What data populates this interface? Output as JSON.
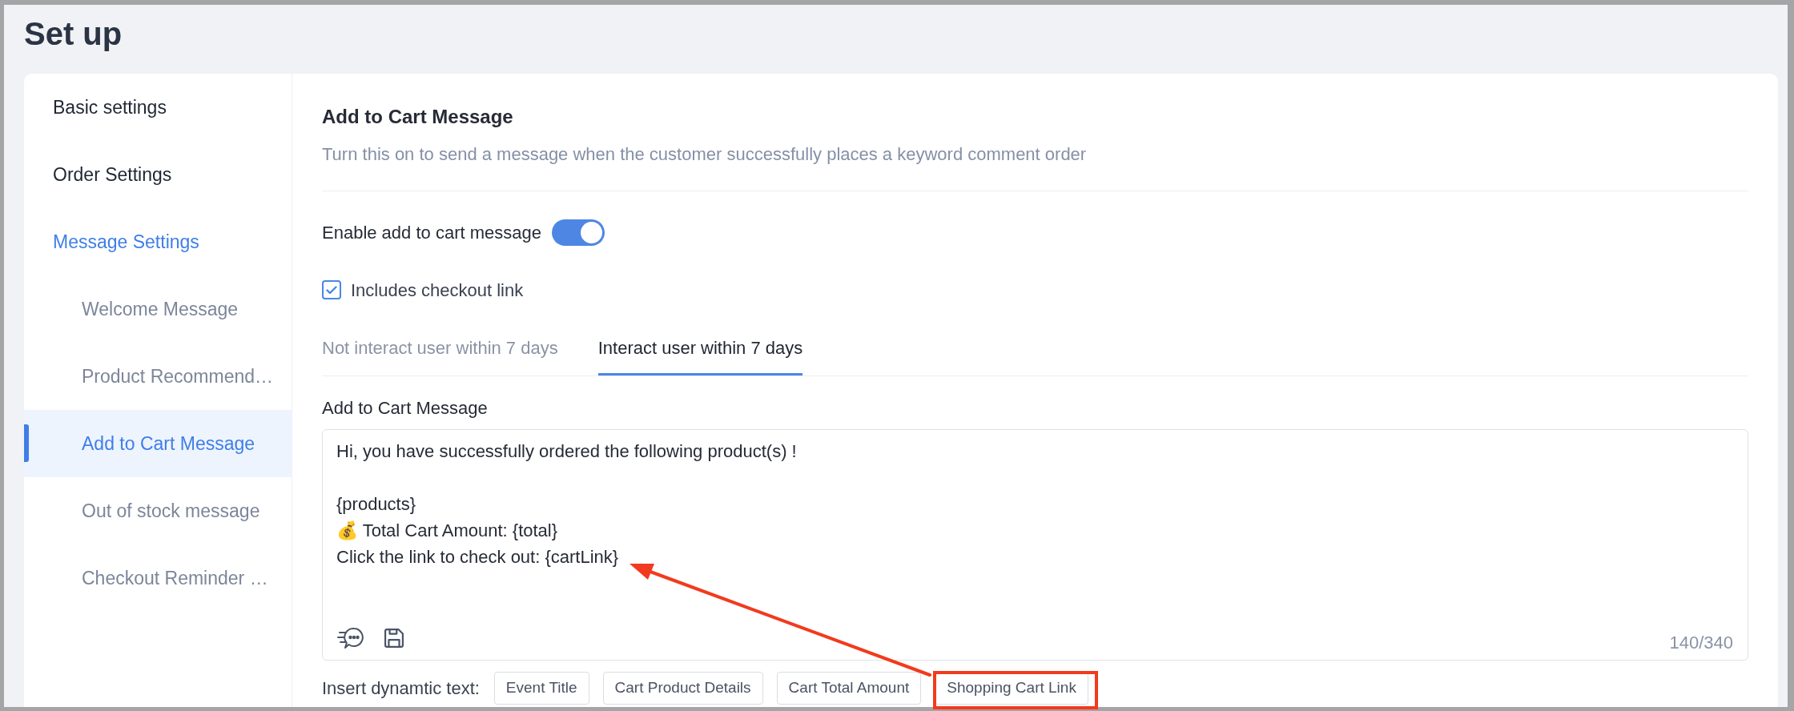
{
  "page": {
    "title": "Set up"
  },
  "sidebar": {
    "items": [
      {
        "label": "Basic settings",
        "selected": false
      },
      {
        "label": "Order Settings",
        "selected": false
      },
      {
        "label": "Message Settings",
        "selected": true,
        "children": [
          {
            "label": "Welcome Message",
            "selected": false
          },
          {
            "label": "Product Recommend…",
            "selected": false
          },
          {
            "label": "Add to Cart Message",
            "selected": true
          },
          {
            "label": "Out of stock message",
            "selected": false
          },
          {
            "label": "Checkout Reminder …",
            "selected": false
          }
        ]
      }
    ]
  },
  "section": {
    "title": "Add to Cart Message",
    "description": "Turn this on to send a message when the customer successfully places a keyword comment order"
  },
  "enable_toggle": {
    "label": "Enable add to cart message",
    "on": true
  },
  "checkout_checkbox": {
    "label": "Includes checkout link",
    "checked": true
  },
  "tabs": [
    {
      "label": "Not interact user within 7 days",
      "selected": false
    },
    {
      "label": "Interact user within 7 days",
      "selected": true
    }
  ],
  "message": {
    "label": "Add to Cart Message",
    "value": "Hi, you have successfully ordered the following product(s) !\n\n{products}\n💰 Total Cart Amount: {total}\nClick the link to check out: {cartLink}",
    "counter": "140/340"
  },
  "dynamic_text": {
    "label": "Insert dynamtic text:",
    "buttons": [
      "Event Title",
      "Cart Product Details",
      "Cart Total Amount",
      "Shopping Cart Link"
    ]
  }
}
